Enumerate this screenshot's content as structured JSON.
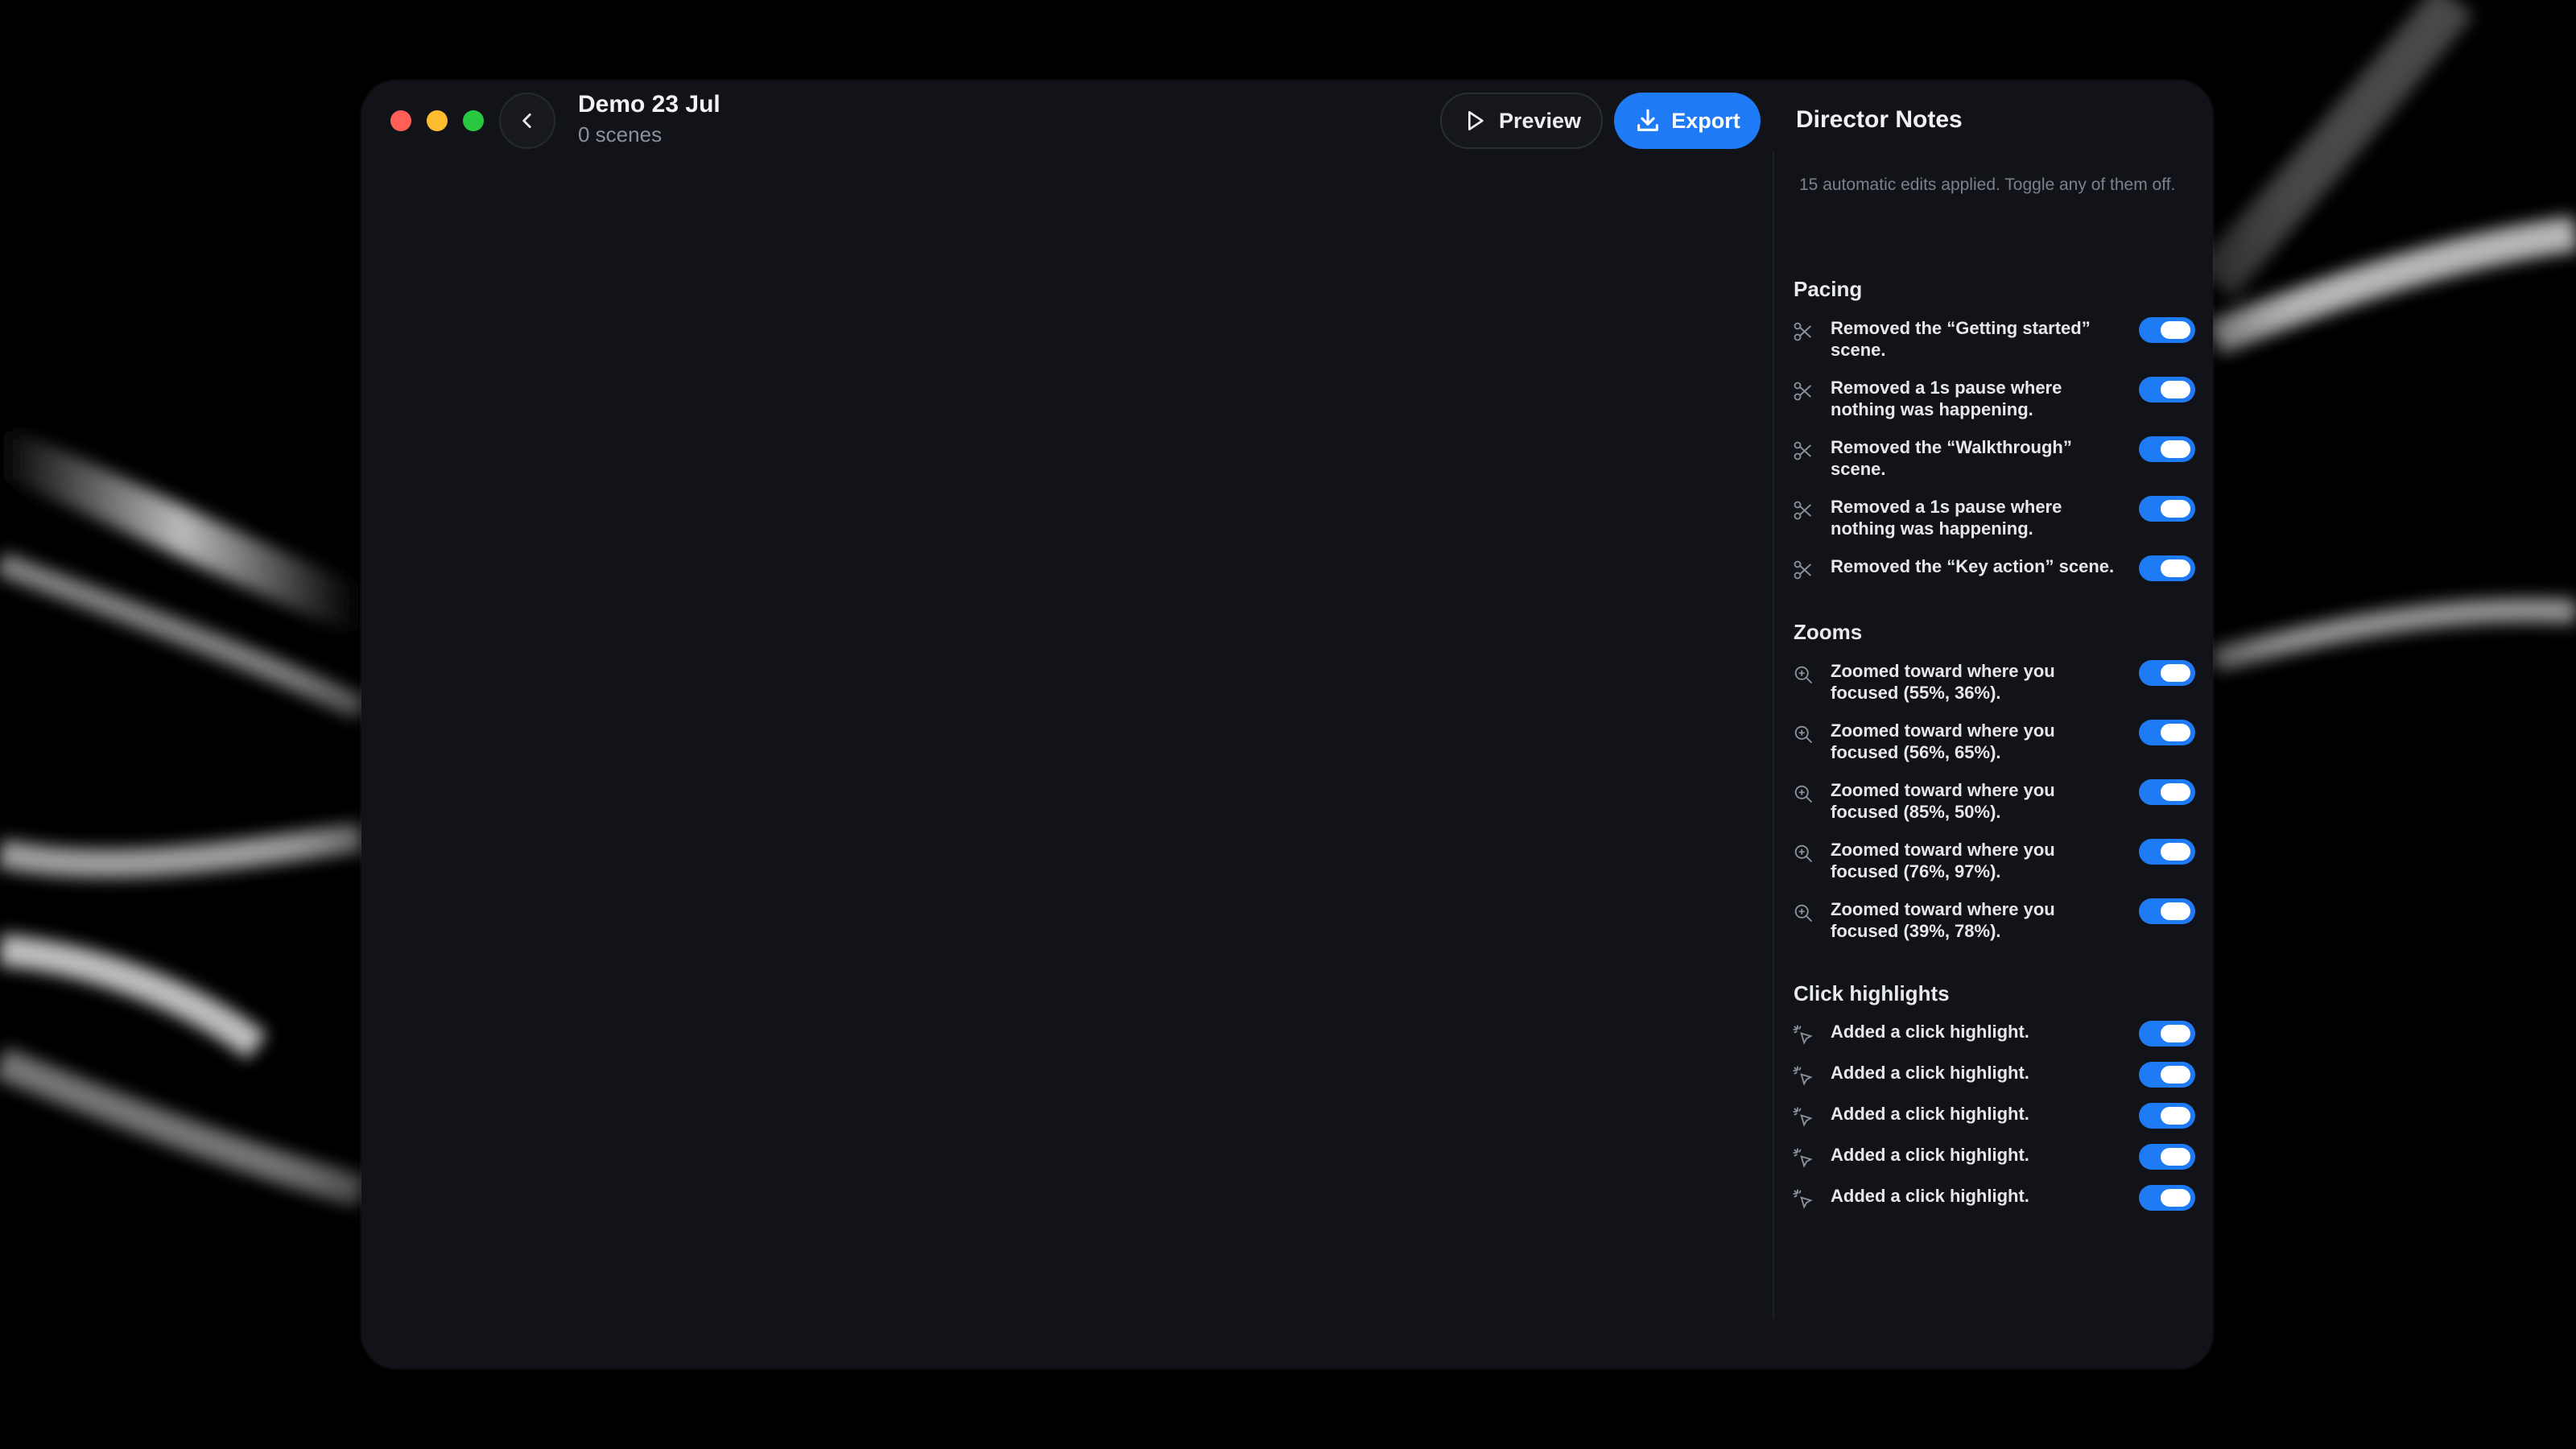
{
  "window": {
    "title": "Demo 23 Jul",
    "subtitle": "0 scenes"
  },
  "toolbar": {
    "preview_label": "Preview",
    "export_label": "Export"
  },
  "colors": {
    "accent": "#1f7bf5",
    "traffic_red": "#ff5f57",
    "traffic_yellow": "#febc2e",
    "traffic_green": "#28c840"
  },
  "director_notes": {
    "title": "Director Notes",
    "description": "15 automatic edits applied. Toggle any of them off.",
    "sections": [
      {
        "title": "Pacing",
        "icon": "scissors-icon",
        "items": [
          {
            "label": "Removed the “Getting started” scene.",
            "enabled": true
          },
          {
            "label": "Removed a 1s pause where nothing was happening.",
            "enabled": true
          },
          {
            "label": "Removed the “Walkthrough” scene.",
            "enabled": true
          },
          {
            "label": "Removed a 1s pause where nothing was happening.",
            "enabled": true
          },
          {
            "label": "Removed the “Key action” scene.",
            "enabled": true
          }
        ]
      },
      {
        "title": "Zooms",
        "icon": "zoom-in-icon",
        "items": [
          {
            "label": "Zoomed toward where you focused (55%, 36%).",
            "enabled": true
          },
          {
            "label": "Zoomed toward where you focused (56%, 65%).",
            "enabled": true
          },
          {
            "label": "Zoomed toward where you focused (85%, 50%).",
            "enabled": true
          },
          {
            "label": "Zoomed toward where you focused (76%, 97%).",
            "enabled": true
          },
          {
            "label": "Zoomed toward where you focused (39%, 78%).",
            "enabled": true
          }
        ]
      },
      {
        "title": "Click highlights",
        "icon": "click-sparkle-icon",
        "items": [
          {
            "label": "Added a click highlight.",
            "enabled": true
          },
          {
            "label": "Added a click highlight.",
            "enabled": true
          },
          {
            "label": "Added a click highlight.",
            "enabled": true
          },
          {
            "label": "Added a click highlight.",
            "enabled": true
          },
          {
            "label": "Added a click highlight.",
            "enabled": true
          }
        ]
      }
    ]
  }
}
